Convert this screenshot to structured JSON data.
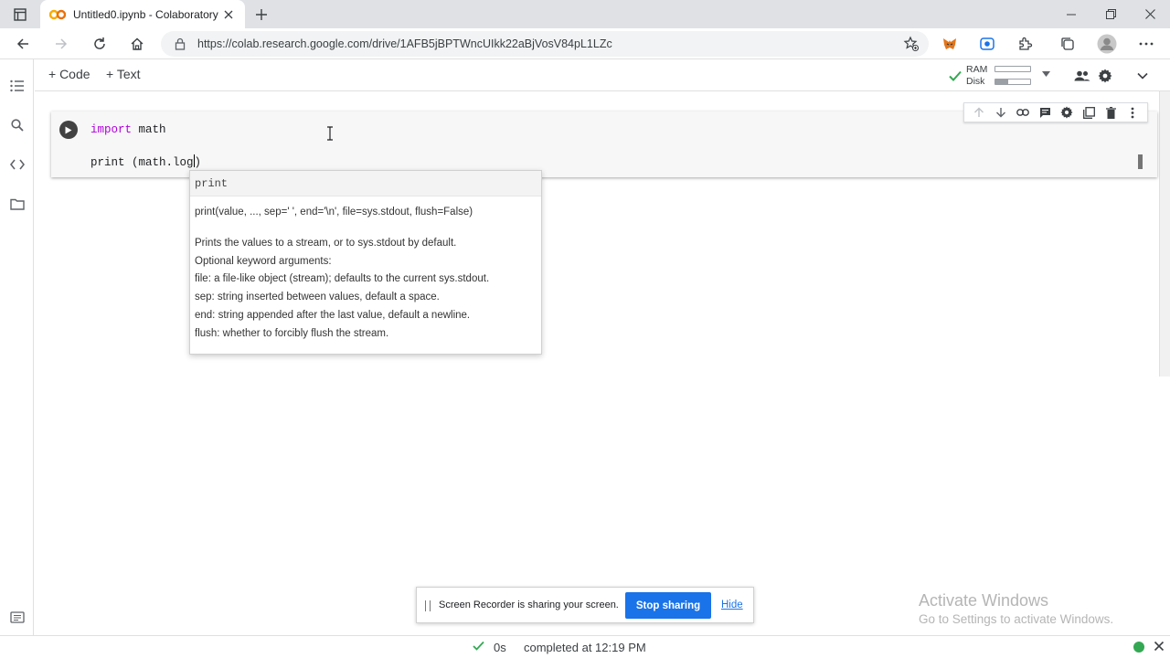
{
  "browser": {
    "tab_title": "Untitled0.ipynb - Colaboratory",
    "url": "https://colab.research.google.com/drive/1AFB5jBPTWncUIkk22aBjVosV84pL1LZc"
  },
  "colab": {
    "add_code_label": "+ Code",
    "add_text_label": "+ Text",
    "resources": {
      "ram_label": "RAM",
      "disk_label": "Disk",
      "ram_fraction": 0.0,
      "disk_fraction": 0.38,
      "status_color": "#34a853"
    },
    "cell": {
      "line1_keyword": "import",
      "line1_rest": " math",
      "line2_before_caret": "print (math.log",
      "line2_after_caret": ")"
    },
    "tooltip": {
      "name": "print",
      "signature": "print(value, ..., sep=' ', end='\\n', file=sys.stdout, flush=False)",
      "doc_lines": [
        "Prints the values to a stream, or to sys.stdout by default.",
        "Optional keyword arguments:",
        "file:  a file-like object (stream); defaults to the current sys.stdout.",
        "sep:   string inserted between values, default a space.",
        "end:   string appended after the last value, default a newline.",
        "flush: whether to forcibly flush the stream."
      ]
    },
    "status": {
      "duration": "0s",
      "completed": "completed at 12:19 PM"
    }
  },
  "sharing_bar": {
    "message": "Screen Recorder is sharing your screen.",
    "stop_label": "Stop sharing",
    "hide_label": "Hide",
    "accent": "#1a73e8"
  },
  "watermark": {
    "title": "Activate Windows",
    "subtitle": "Go to Settings to activate Windows."
  }
}
